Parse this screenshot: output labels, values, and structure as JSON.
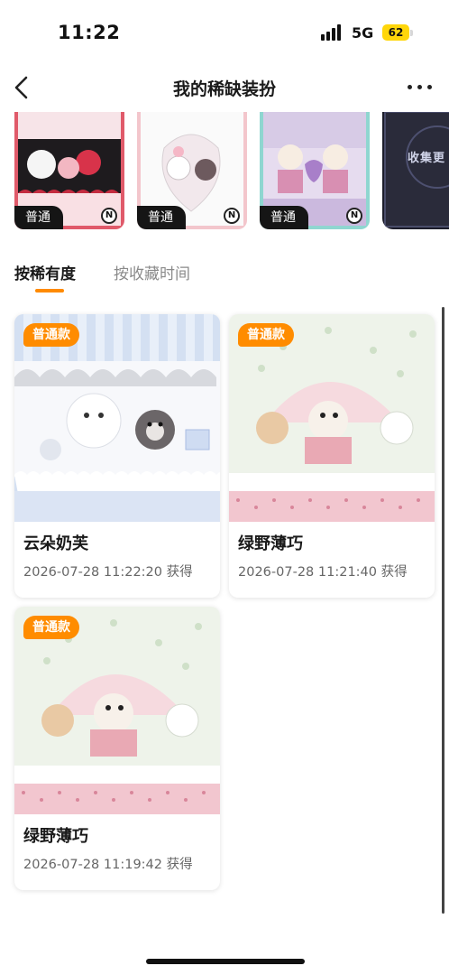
{
  "status_bar": {
    "time": "11:22",
    "network": "5G",
    "battery": "62"
  },
  "header": {
    "title": "我的稀缺装扮"
  },
  "showcase": {
    "items": [
      {
        "tag": "普通",
        "badge": "N"
      },
      {
        "tag": "普通",
        "badge": "N"
      },
      {
        "tag": "普通",
        "badge": "N"
      }
    ],
    "more_card_text": "收集更"
  },
  "tabs": [
    {
      "label": "按稀有度",
      "active": true
    },
    {
      "label": "按收藏时间",
      "active": false
    }
  ],
  "colors": {
    "accent": "#ff8c00",
    "badge_bg": "#151515"
  },
  "cards": [
    {
      "badge": "普通款",
      "name": "云朵奶芙",
      "date": "2026-07-28 11:22:20 获得"
    },
    {
      "badge": "普通款",
      "name": "绿野薄巧",
      "date": "2026-07-28 11:21:40 获得"
    },
    {
      "badge": "普通款",
      "name": "绿野薄巧",
      "date": "2026-07-28 11:19:42 获得"
    }
  ]
}
